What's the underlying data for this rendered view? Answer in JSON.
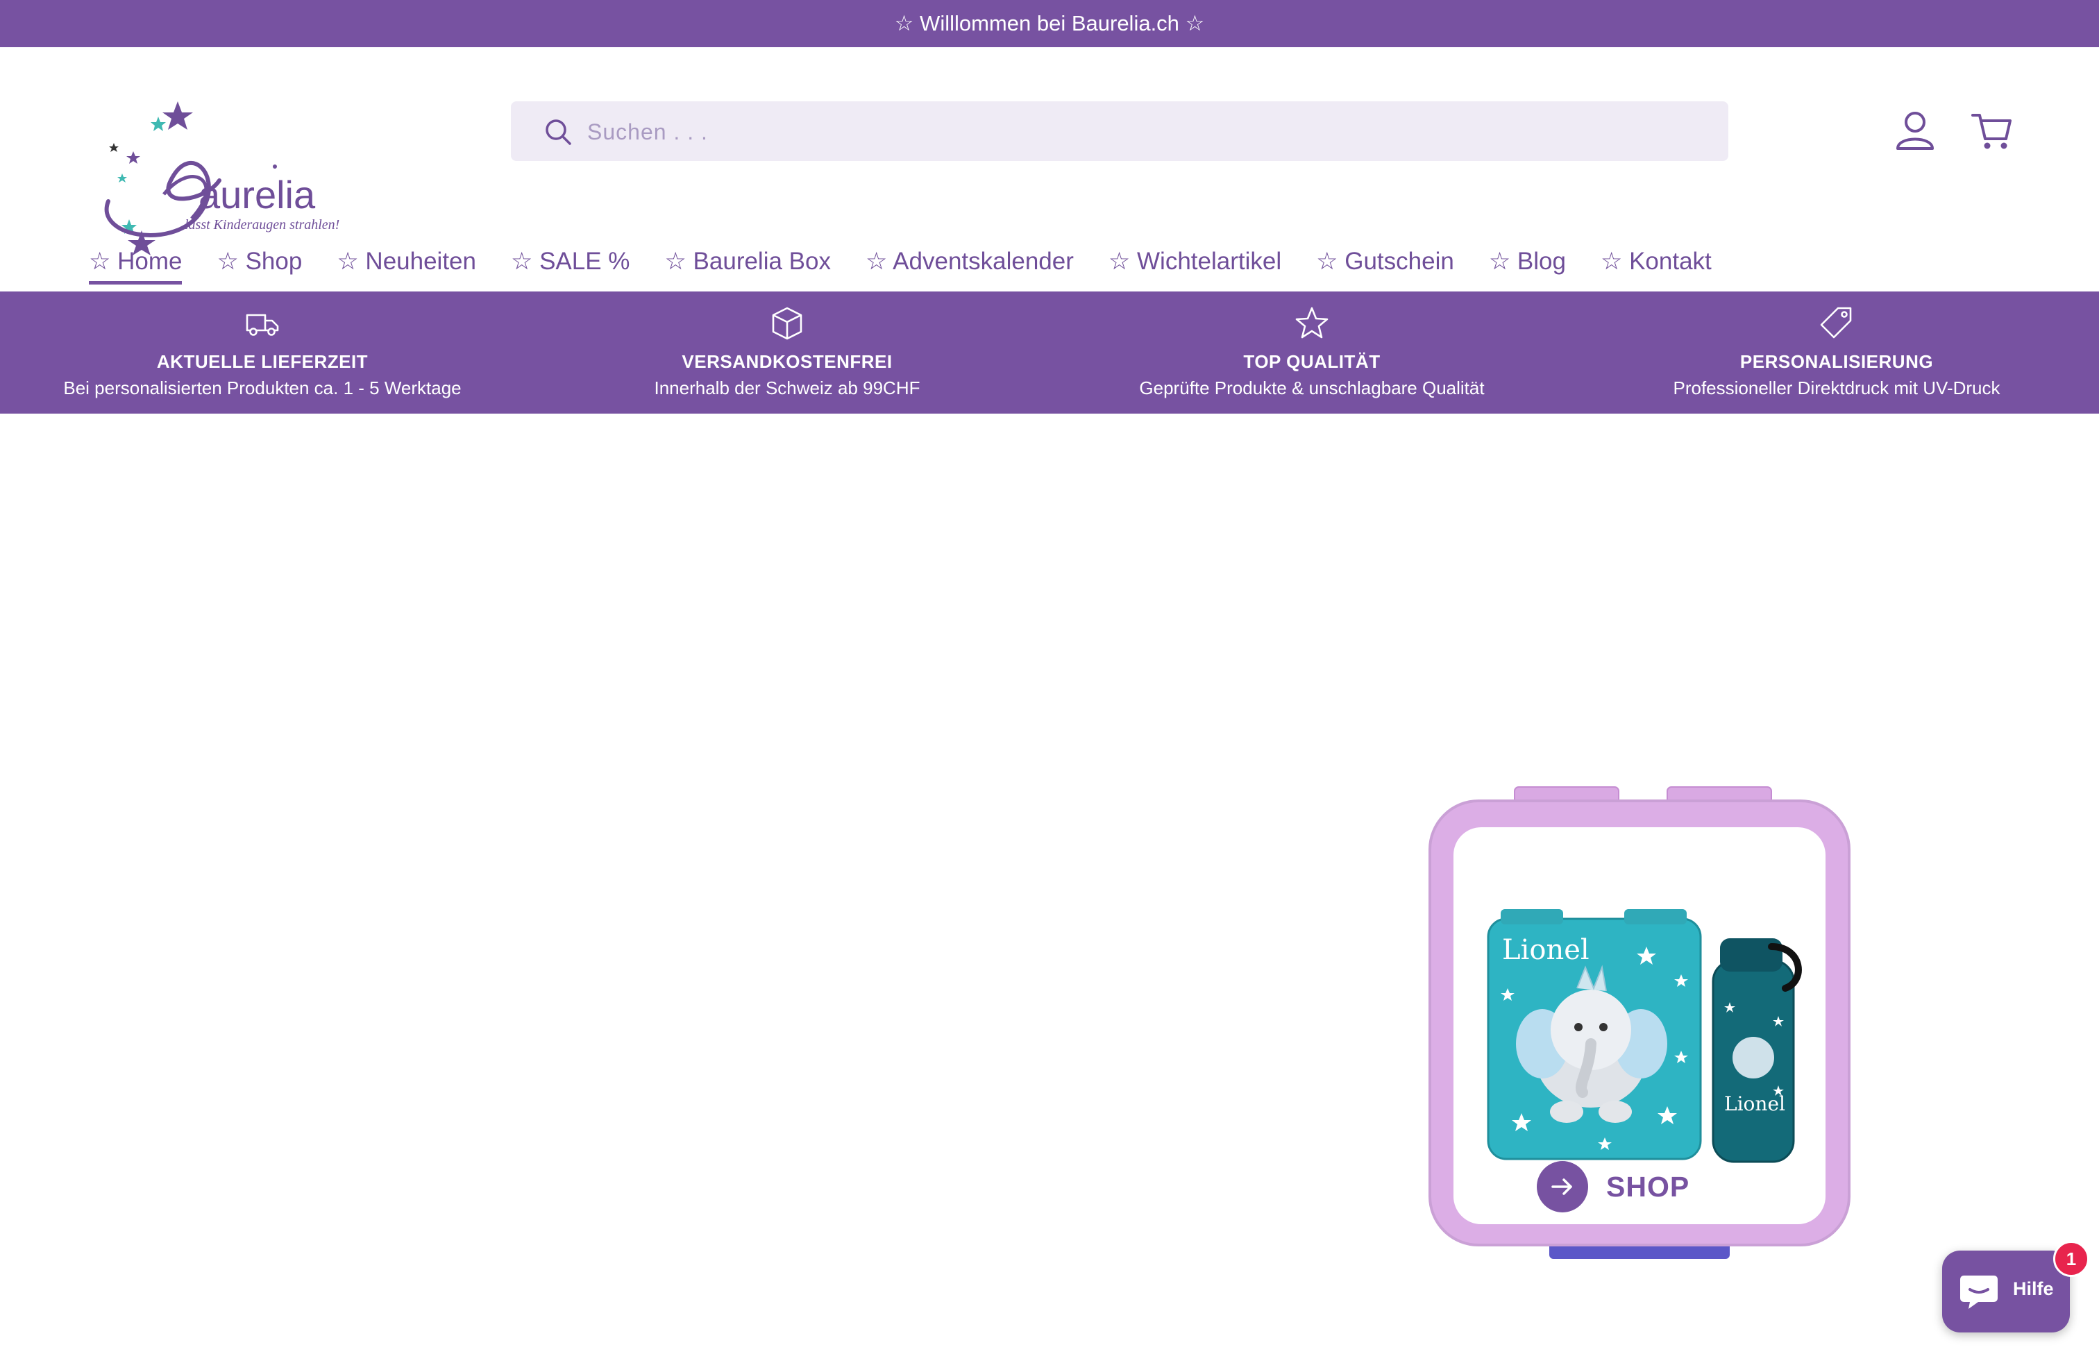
{
  "announcement": {
    "text": "☆ Willlommen bei Baurelia.ch ☆"
  },
  "brand": {
    "name": "Baurelia",
    "tagline": "lässt Kinderaugen strahlen!"
  },
  "search": {
    "placeholder": "Suchen . . ."
  },
  "header_icons": {
    "account": "user-icon",
    "cart": "cart-icon"
  },
  "nav": {
    "items": [
      {
        "label": "☆ Home",
        "active": true
      },
      {
        "label": "☆ Shop"
      },
      {
        "label": "☆ Neuheiten"
      },
      {
        "label": "☆ SALE %"
      },
      {
        "label": "☆ Baurelia Box"
      },
      {
        "label": "☆ Adventskalender"
      },
      {
        "label": "☆ Wichtelartikel"
      },
      {
        "label": "☆ Gutschein"
      },
      {
        "label": "☆ Blog"
      },
      {
        "label": "☆ Kontakt"
      }
    ]
  },
  "features": [
    {
      "icon": "truck-icon",
      "title": "AKTUELLE LIEFERZEIT",
      "desc": "Bei personalisierten Produkten ca. 1 - 5 Werktage"
    },
    {
      "icon": "box-icon",
      "title": "VERSANDKOSTENFREI",
      "desc": "Innerhalb der Schweiz ab 99CHF"
    },
    {
      "icon": "star-icon",
      "title": "TOP QUALITÄT",
      "desc": "Geprüfte Produkte & unschlagbare Qualität"
    },
    {
      "icon": "tag-icon",
      "title": "PERSONALISIERUNG",
      "desc": "Professioneller Direktdruck mit UV-Druck"
    }
  ],
  "promo": {
    "product_name": "Lionel",
    "button_label": "SHOP"
  },
  "help_widget": {
    "label": "Hilfe",
    "badge_count": "1"
  },
  "colors": {
    "brand_purple": "#7752a1",
    "search_bg": "#efebf5",
    "box_lid": "#dcaee6",
    "teal": "#2eb4c3",
    "badge_red": "#e8244d"
  }
}
